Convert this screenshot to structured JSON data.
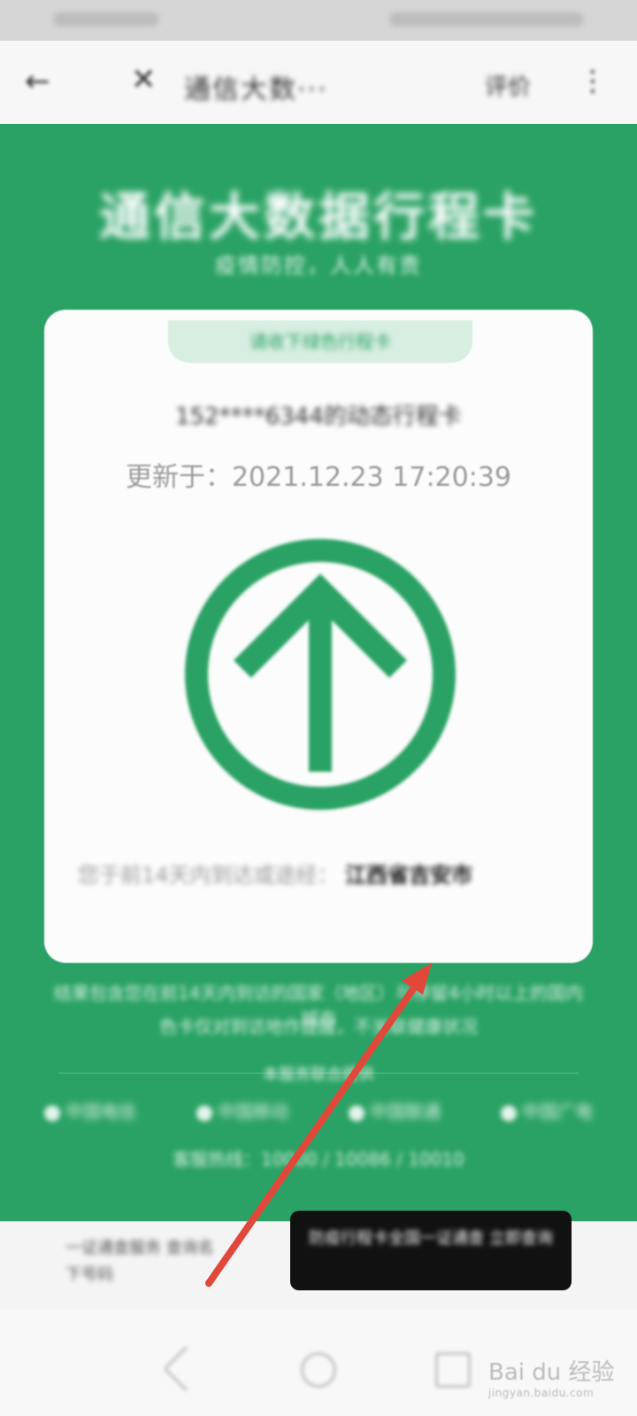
{
  "status_bar": {},
  "nav": {
    "back_icon": "back-arrow-icon",
    "close_icon": "close-icon",
    "title": "通信大数···",
    "action": "评价",
    "more_icon": "more-vertical-icon"
  },
  "page": {
    "title": "通信大数据行程卡",
    "subtitle": "疫情防控，人人有责"
  },
  "card": {
    "tab_label": "请收下绿色行程卡",
    "phone_line": "152****6344的动态行程卡",
    "update_time": "更新于：2021.12.23 17:20:39",
    "status_icon": "green-up-arrow-circle-icon",
    "status_color": "#2aa265",
    "note_text": "您于前14天内到达或途经：",
    "note_place": "江西省吉安市"
  },
  "footer": {
    "line1": "结果包含您在前14天内到访的国家（地区）与停留4小时以上的国内城市",
    "line2": "色卡仅对到访地作提醒，不关联健康状况",
    "divider_label": "本服务联合提供",
    "links": [
      "中国电信",
      "中国移动",
      "中国联通",
      "中国广电"
    ],
    "link_icons": [
      "telecom-icon",
      "mobile-icon",
      "unicom-icon",
      "broadcast-icon"
    ],
    "service_line": "客服热线：10000 / 10086 / 10010"
  },
  "bottom_bar": {
    "left_text": "一证通查服务 查询名下号码",
    "cta_label": "防疫行程卡全国一证通查 立即查询"
  },
  "system_nav": {
    "back_icon": "system-back-icon",
    "home_icon": "system-home-icon",
    "recent_icon": "system-recent-icon"
  },
  "watermark": {
    "text": "Bai du 经验",
    "url": "jingyan.baidu.com"
  },
  "annotation": {
    "arrow_color": "#e2483a"
  }
}
